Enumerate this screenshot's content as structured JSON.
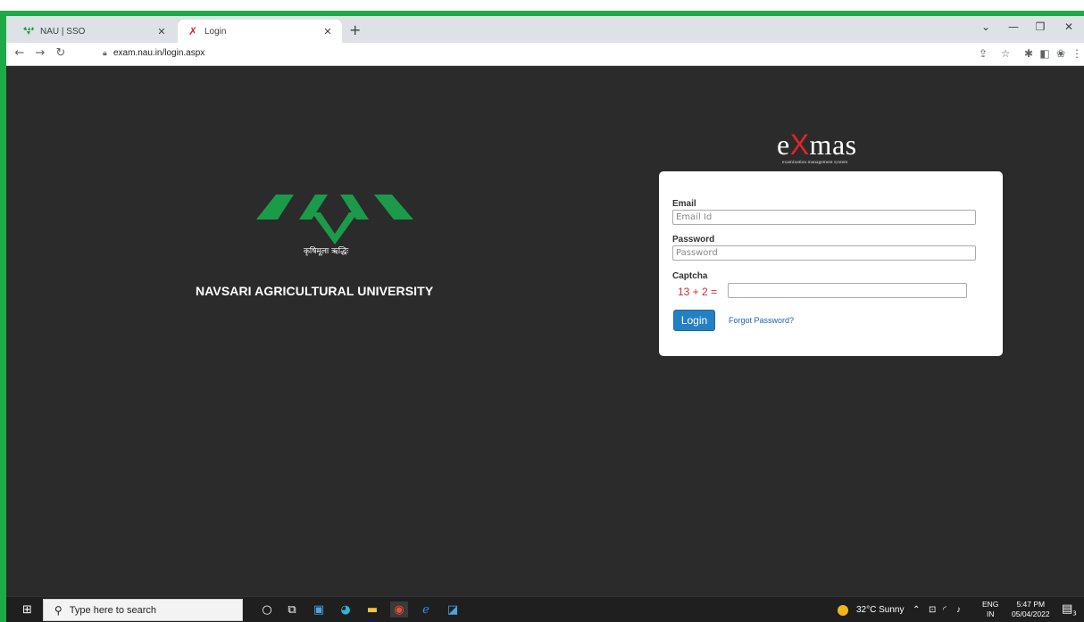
{
  "browser": {
    "tabs": [
      {
        "title": "NAU | SSO",
        "favicon": "nau-logo-icon"
      },
      {
        "title": "Login",
        "favicon": "exmas-x-icon",
        "active": true
      }
    ],
    "new_tab": "+",
    "url": "exam.nau.in/login.aspx"
  },
  "page": {
    "motto": "कृषिमूला ऋद्धिः",
    "university": "NAVSARI AGRICULTURAL UNIVERSITY",
    "brand": {
      "pre": "e",
      "x": "X",
      "post": "mas",
      "tagline": "examination management system"
    },
    "form": {
      "email_label": "Email",
      "email_placeholder": "Email Id",
      "password_label": "Password",
      "password_placeholder": "Password",
      "captcha_label": "Captcha",
      "captcha_question": "13 + 2 =",
      "login_button": "Login",
      "forgot_link": "Forgot Password?"
    }
  },
  "taskbar": {
    "search_placeholder": "Type here to search",
    "weather": "32°C  Sunny",
    "lang_top": "ENG",
    "lang_bottom": "IN",
    "time": "5:47 PM",
    "date": "05/04/2022",
    "notification_count": "3"
  },
  "colors": {
    "window_border": "#1faa4a",
    "logo_green": "#1b9a4a",
    "login_button": "#2480c2",
    "captcha_text": "#d42b2b"
  }
}
